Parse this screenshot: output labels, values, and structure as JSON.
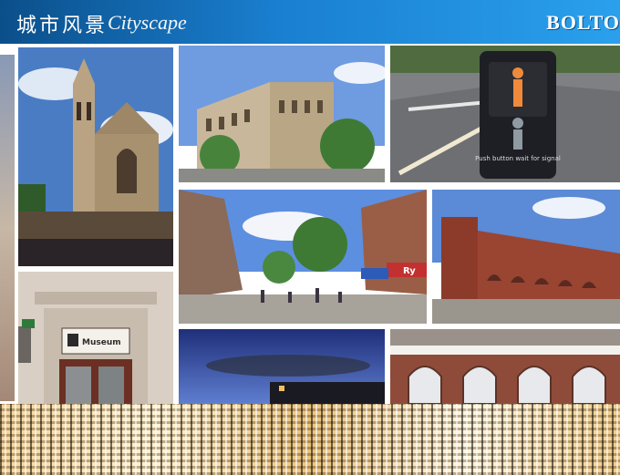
{
  "banner": {
    "title_cn": "城市风景",
    "title_en": "Cityscape",
    "brand": "BOLTO"
  },
  "photos": {
    "crossing_sign": "Push button wait for signal",
    "museum_sign": "Museum",
    "shop_sign": "Ry"
  },
  "colors": {
    "banner_dark": "#0b4f8a",
    "banner_light": "#2aa0ec",
    "sky": "#5b86c8",
    "brick": "#8c3b2a"
  }
}
